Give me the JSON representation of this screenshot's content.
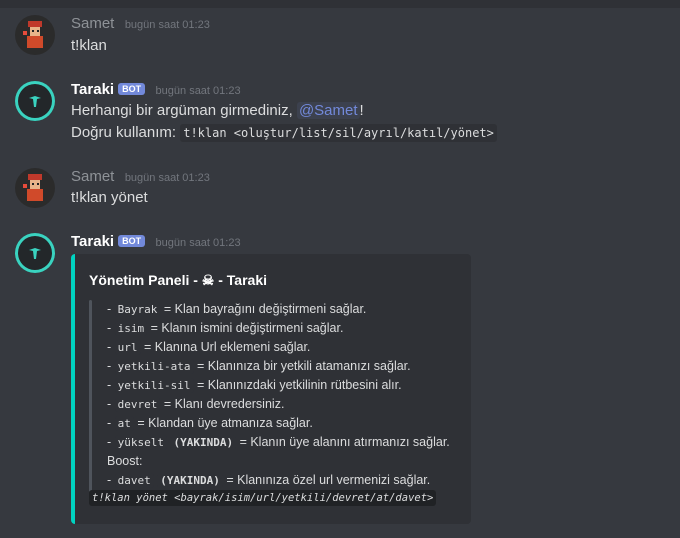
{
  "messages": [
    {
      "author": "Samet",
      "time": "bugün saat 01:23",
      "text": "t!klan"
    },
    {
      "author": "Taraki",
      "badge": "BOT",
      "time": "bugün saat 01:23",
      "line1_prefix": "Herhangi bir argüman girmediniz, ",
      "mention": "@Samet",
      "line1_suffix": "!",
      "line2_prefix": "Doğru kullanım: ",
      "line2_code": "t!klan <oluştur/list/sil/ayrıl/katıl/yönet>"
    },
    {
      "author": "Samet",
      "time": "bugün saat 01:23",
      "text": "t!klan yönet"
    },
    {
      "author": "Taraki",
      "badge": "BOT",
      "time": "bugün saat 01:23"
    }
  ],
  "embed": {
    "title": "Yönetim Paneli - ☠ - Taraki",
    "color": "#00d3c1",
    "lines": [
      {
        "dash": "- ",
        "code": "Bayrak",
        "text": " = Klan bayrağını değiştirmeni sağlar."
      },
      {
        "dash": "- ",
        "code": "isim",
        "text": " = Klanın ismini değiştirmeni sağlar."
      },
      {
        "dash": "- ",
        "code": "url",
        "text": " = Klanına Url eklemeni sağlar."
      },
      {
        "dash": "- ",
        "code": "yetkili-ata",
        "text": " = Klanınıza bir yetkili atamanızı sağlar."
      },
      {
        "dash": "- ",
        "code": "yetkili-sil",
        "text": " = Klanınızdaki yetkilinin rütbesini alır."
      },
      {
        "dash": "- ",
        "code": "devret",
        "text": " = Klanı devredersiniz."
      },
      {
        "dash": "- ",
        "code": "at",
        "text": " = Klandan üye atmanıza sağlar."
      },
      {
        "dash": "- ",
        "code": "yükselt",
        "extra": "(YAKINDA)",
        "text": " = Klanın üye alanını atırmanızı sağlar."
      },
      {
        "plain": "Boost:"
      },
      {
        "dash": "- ",
        "code": "davet",
        "extra": "(YAKINDA)",
        "text": " = Klanınıza özel url vermenizi sağlar."
      }
    ],
    "footer_code": "t!klan yönet <bayrak/isim/url/yetkili/devret/at/davet>"
  }
}
